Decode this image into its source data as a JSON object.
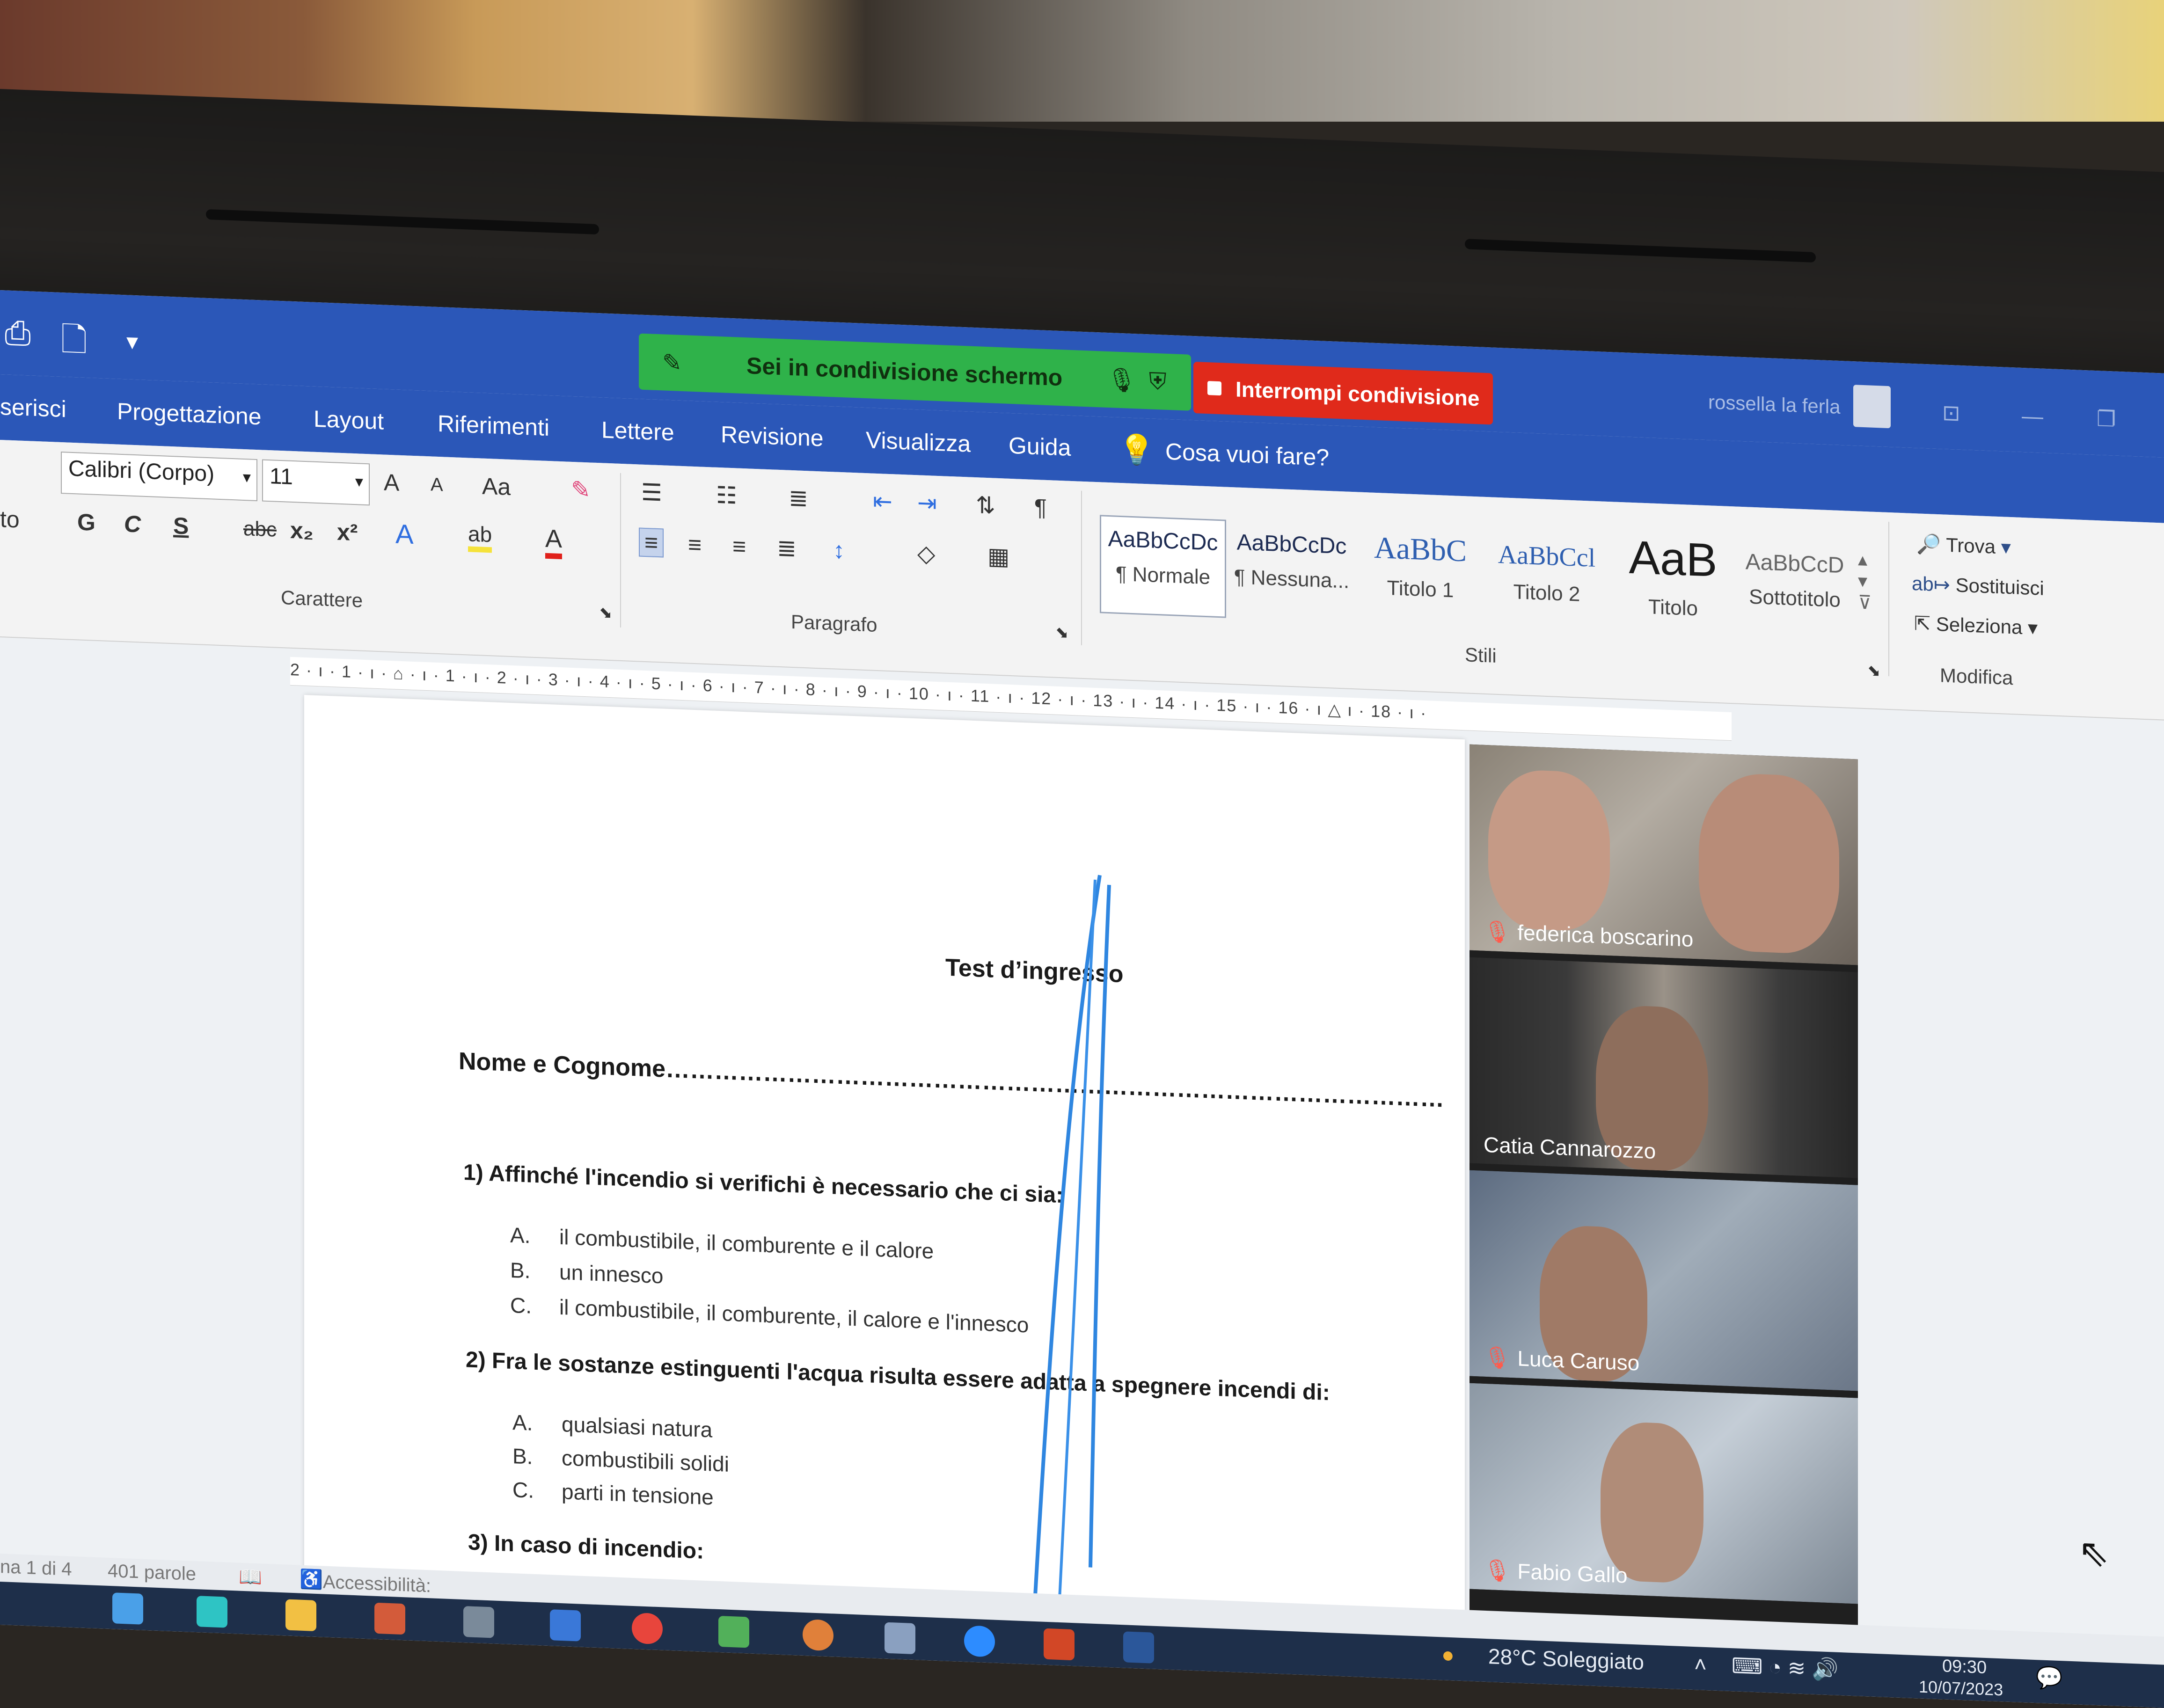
{
  "quick_access": {
    "icons": [
      "print-preview-icon",
      "new-document-icon",
      "customize-qat-icon"
    ]
  },
  "screen_share": {
    "banner_text": "Sei in condivisione schermo",
    "stop_label": "Interrompi condivisione"
  },
  "user": {
    "name": "rossella la ferla"
  },
  "menu": {
    "tabs": [
      "serisci",
      "Progettazione",
      "Layout",
      "Riferimenti",
      "Lettere",
      "Revisione",
      "Visualizza",
      "Guida"
    ],
    "tell_me": "Cosa vuoi fare?"
  },
  "ribbon": {
    "left_cut_label": "to",
    "font_name": "Calibri (Corpo)",
    "font_size": "11",
    "font_buttons": [
      "A",
      "A",
      "Aa"
    ],
    "format_buttons": [
      "G",
      "C",
      "S",
      "abc",
      "x₂",
      "x²"
    ],
    "groups": {
      "font": "Carattere",
      "paragraph": "Paragrafo",
      "styles": "Stili",
      "editing": "Modifica"
    },
    "styles": [
      {
        "sample": "AaBbCcDc",
        "name": "¶ Normale"
      },
      {
        "sample": "AaBbCcDc",
        "name": "¶ Nessuna..."
      },
      {
        "sample": "AaBbC",
        "name": "Titolo 1"
      },
      {
        "sample": "AaBbCcl",
        "name": "Titolo 2"
      },
      {
        "sample": "AaB",
        "name": "Titolo"
      },
      {
        "sample": "AaBbCcD",
        "name": "Sottotitolo"
      }
    ],
    "editing": {
      "find": "Trova",
      "replace": "Sostituisci",
      "select": "Seleziona"
    }
  },
  "ruler": {
    "marks": "2 · ı · 1 · ı · ⌂ · ı · 1 · ı · 2 · ı · 3 · ı · 4 · ı · 5 · ı · 6 · ı · 7 · ı · 8 · ı · 9 · ı · 10 · ı · 11 · ı · 12 · ı · 13 · ı · 14 · ı · 15 · ı · 16 · ı △ ı · 18 · ı ·"
  },
  "document": {
    "title": "Test d’ingresso",
    "name_line": "Nome e Cognome……………………………………………………………………………………",
    "q1": "1) Affinché l'incendio si verifichi è necessario che ci sia:",
    "q1_options": [
      {
        "letter": "A.",
        "text": "il combustibile, il comburente e il calore"
      },
      {
        "letter": "B.",
        "text": "un innesco"
      },
      {
        "letter": "C.",
        "text": "il combustibile, il comburente, il calore e l'innesco"
      }
    ],
    "q2": "2) Fra le sostanze estinguenti l'acqua risulta essere adatta a spegnere incendi di:",
    "q2_options": [
      {
        "letter": "A.",
        "text": "qualsiasi natura"
      },
      {
        "letter": "B.",
        "text": "combustibili solidi"
      },
      {
        "letter": "C.",
        "text": "parti in tensione"
      }
    ],
    "q3": "3) In caso di incendio:"
  },
  "participants": [
    {
      "name": "federica boscarino",
      "muted": true
    },
    {
      "name": "Catia Cannarozzo",
      "muted": false
    },
    {
      "name": "Luca Caruso",
      "muted": true
    },
    {
      "name": "Fabio Gallo",
      "muted": true
    }
  ],
  "status_bar": {
    "page": "na 1 di 4",
    "words": "401 parole",
    "accessibility": "Accessibilità: conforme"
  },
  "taskbar": {
    "weather": "28°C  Soleggiato",
    "time": "09:30",
    "date": "10/07/2023"
  },
  "colors": {
    "word_blue": "#2b57b8",
    "share_green": "#2fb24a",
    "stop_red": "#e02a1b"
  }
}
